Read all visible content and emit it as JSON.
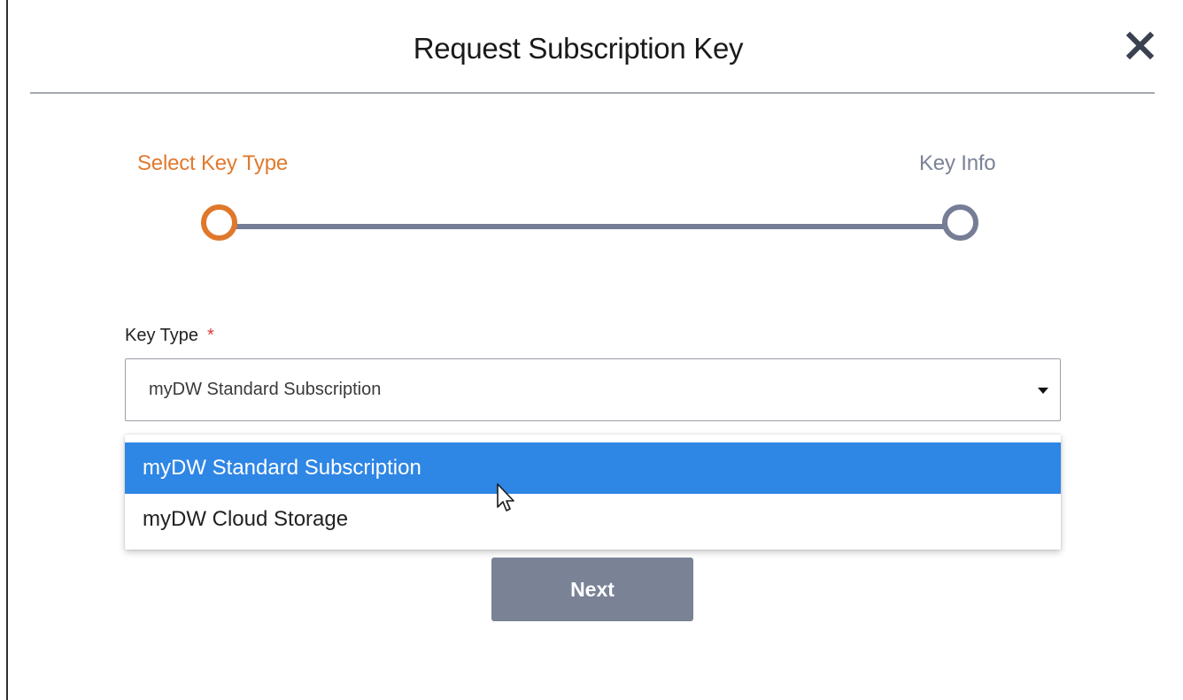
{
  "dialog": {
    "title": "Request Subscription Key",
    "close_icon": "close-icon"
  },
  "stepper": {
    "steps": [
      {
        "label": "Select Key Type",
        "state": "active"
      },
      {
        "label": "Key Info",
        "state": "inactive"
      }
    ],
    "active_color": "#e0782c",
    "inactive_color": "#767d95"
  },
  "form": {
    "key_type": {
      "label": "Key Type",
      "required_mark": "*",
      "value": "myDW Standard Subscription",
      "caret_icon": "caret-down-icon",
      "options": [
        {
          "label": "myDW Standard Subscription",
          "highlighted": true
        },
        {
          "label": "myDW Cloud Storage",
          "highlighted": false
        }
      ]
    }
  },
  "actions": {
    "next_label": "Next"
  },
  "colors": {
    "highlight": "#2e86e5",
    "button": "#7a8296",
    "required": "#e03a3a"
  }
}
